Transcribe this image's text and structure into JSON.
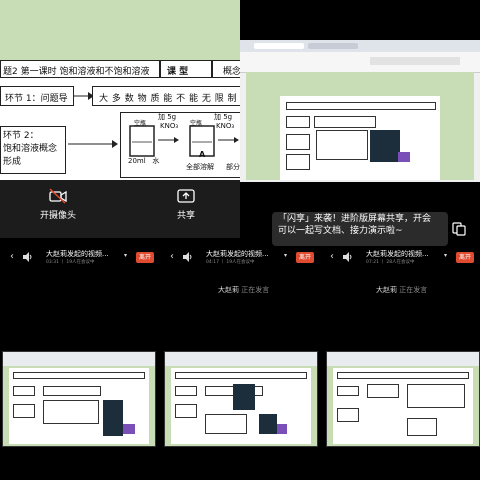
{
  "lesson_panel": {
    "header": {
      "topic": "题2 第一课时 饱和溶液和不饱和溶液",
      "type_label": "课  型",
      "concept_label": "概念"
    },
    "step1": "环节 1：问题导",
    "step2_line1": "环节 2：",
    "step2_line2": "饱和溶液概念",
    "step2_line3": "形成",
    "statement": "大 多 数 物 质 能 不 能 无 限 制 的 溶 解",
    "beaker_label": "空瓶",
    "add_label": "加 5g",
    "kno3": "KNO₃",
    "water": "20ml   水",
    "marker_a": "A",
    "all_dissolved": "全部溶解",
    "partial": "部分"
  },
  "controls": {
    "camera_label": "开摄像头",
    "share_label": "共享"
  },
  "toast": {
    "text": "「闪享」来袭！进阶版屏幕共享，开会可以一起写文档、接力演示啦~"
  },
  "participants": [
    {
      "title": "大赵莉发起的视频...",
      "meta": "03:31 丨 19人在会议中",
      "leave": "离开"
    },
    {
      "title": "大赵莉发起的视频...",
      "meta": "04:17 丨 19人在会议中",
      "leave": "离开"
    },
    {
      "title": "大赵莉发起的视频...",
      "meta": "07:21 丨 28人在会议中",
      "leave": "离开"
    }
  ],
  "speakers": [
    {
      "name": "大赵莉",
      "status": "正在发言"
    },
    {
      "name": "大赵莉",
      "status": "正在发言"
    }
  ],
  "colors": {
    "doc_green": "#c8dcb6",
    "leave_red": "#e04a2f",
    "toast_bg": "#2b2b2b"
  },
  "icons": [
    "camera-off-icon",
    "share-screen-icon",
    "chevron-left-icon",
    "speaker-icon",
    "chevron-down-icon",
    "window-icon"
  ]
}
